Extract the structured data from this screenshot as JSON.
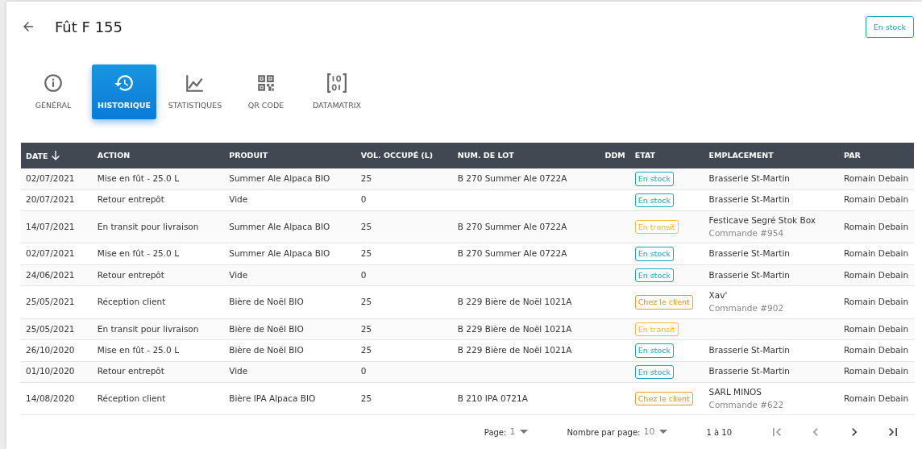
{
  "header": {
    "title": "Fût F 155",
    "status": {
      "label": "En stock",
      "kind": "stock"
    }
  },
  "tabs": [
    {
      "label": "GÉNÉRAL",
      "selected": false
    },
    {
      "label": "HISTORIQUE",
      "selected": true
    },
    {
      "label": "STATISTIQUES",
      "selected": false
    },
    {
      "label": "QR CODE",
      "selected": false
    },
    {
      "label": "DATAMATRIX",
      "selected": false
    }
  ],
  "table": {
    "columns": [
      {
        "label": "DATE",
        "sorted": true
      },
      {
        "label": "ACTION"
      },
      {
        "label": "PRODUIT"
      },
      {
        "label": "VOL. OCCUPÉ (L)"
      },
      {
        "label": "NUM. DE LOT"
      },
      {
        "label": "DDM"
      },
      {
        "label": "ETAT"
      },
      {
        "label": "EMPLACEMENT"
      },
      {
        "label": "PAR"
      }
    ],
    "rows": [
      {
        "date": "02/07/2021",
        "action": "Mise en fût - 25.0 L",
        "product": "Summer Ale Alpaca BIO",
        "volume": "25",
        "lot": "B 270 Summer Ale 0722A",
        "state": {
          "label": "En stock",
          "kind": "stock"
        },
        "location": "Brasserie St-Martin",
        "by": "Romain Debain"
      },
      {
        "date": "20/07/2021",
        "action": "Retour entrepôt",
        "product": "Vide",
        "volume": "0",
        "state": {
          "label": "En stock",
          "kind": "stock"
        },
        "location": "Brasserie St-Martin",
        "by": "Romain Debain"
      },
      {
        "date": "14/07/2021",
        "action": "En transit pour livraison",
        "product": "Summer Ale Alpaca BIO",
        "volume": "25",
        "lot": "B 270 Summer Ale 0722A",
        "state": {
          "label": "En transit",
          "kind": "transit"
        },
        "location": "Festicave Segré Stok Box",
        "order": "Commande #954",
        "by": "Romain Debain"
      },
      {
        "date": "02/07/2021",
        "action": "Mise en fût - 25.0 L",
        "product": "Summer Ale Alpaca BIO",
        "volume": "25",
        "lot": "B 270 Summer Ale 0722A",
        "state": {
          "label": "En stock",
          "kind": "stock"
        },
        "location": "Brasserie St-Martin",
        "by": "Romain Debain"
      },
      {
        "date": "24/06/2021",
        "action": "Retour entrepôt",
        "product": "Vide",
        "volume": "0",
        "state": {
          "label": "En stock",
          "kind": "stock"
        },
        "location": "Brasserie St-Martin",
        "by": "Romain Debain"
      },
      {
        "date": "25/05/2021",
        "action": "Réception client",
        "product": "Bière de Noël BIO",
        "volume": "25",
        "lot": "B 229 Bière de Noël 1021A",
        "state": {
          "label": "Chez le client",
          "kind": "client"
        },
        "location": "Xav'",
        "order": "Commande #902",
        "by": "Romain Debain"
      },
      {
        "date": "25/05/2021",
        "action": "En transit pour livraison",
        "product": "Bière de Noël BIO",
        "volume": "25",
        "lot": "B 229 Bière de Noël 1021A",
        "state": {
          "label": "En transit",
          "kind": "transit"
        },
        "by": "Romain Debain"
      },
      {
        "date": "26/10/2020",
        "action": "Mise en fût - 25.0 L",
        "product": "Bière de Noël BIO",
        "volume": "25",
        "lot": "B 229 Bière de Noël 1021A",
        "state": {
          "label": "En stock",
          "kind": "stock"
        },
        "location": "Brasserie St-Martin",
        "by": "Romain Debain"
      },
      {
        "date": "01/10/2020",
        "action": "Retour entrepôt",
        "product": "Vide",
        "volume": "0",
        "state": {
          "label": "En stock",
          "kind": "stock"
        },
        "location": "Brasserie St-Martin",
        "by": "Romain Debain"
      },
      {
        "date": "14/08/2020",
        "action": "Réception client",
        "product": "Bière IPA Alpaca BIO",
        "volume": "25",
        "lot": "B 210 IPA 0721A",
        "state": {
          "label": "Chez le client",
          "kind": "client"
        },
        "location": "SARL MINOS",
        "order": "Commande #622",
        "by": "Romain Debain"
      }
    ]
  },
  "pager": {
    "page_label": "Page:",
    "page": "1",
    "per_page_label": "Nombre par page:",
    "per_page": "10",
    "range": "1 à 10",
    "buttons": [
      {
        "kind": "first",
        "disabled": true
      },
      {
        "kind": "prev",
        "disabled": true
      },
      {
        "kind": "next",
        "disabled": false
      },
      {
        "kind": "last",
        "disabled": false
      }
    ]
  }
}
